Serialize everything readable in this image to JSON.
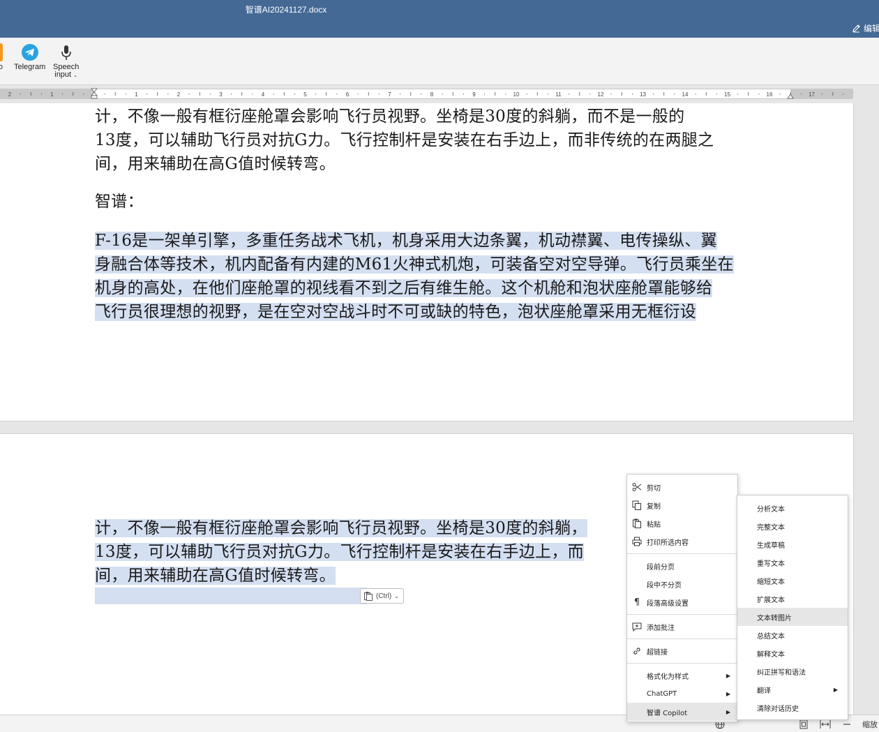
{
  "window": {
    "title": "智谱AI20241127.docx",
    "edit_label": "编辑"
  },
  "ribbon": {
    "items": [
      {
        "label": "io"
      },
      {
        "label": "Telegram"
      },
      {
        "label": "Speech",
        "label2": "input"
      }
    ]
  },
  "ruler": {
    "numbers": [
      "2",
      "1",
      "1",
      "2",
      "3",
      "4",
      "5",
      "6",
      "7",
      "8",
      "9",
      "10",
      "11",
      "12",
      "13",
      "14",
      "15",
      "16",
      "17"
    ]
  },
  "page1": {
    "para1": [
      "计，不像一般有框衍座舱罩会影响飞行员视野。坐椅是30度的斜躺，而不是一般的",
      "13度，可以辅助飞行员对抗G力。飞行控制杆是安装在右手边上，而非传统的在两腿之",
      "间，用来辅助在高G值时候转弯。"
    ],
    "heading": "智谱：",
    "para2": [
      "F-16是一架单引擎，多重任务战术飞机，机身采用大边条翼，机动襟翼、电传操纵、翼",
      "身融合体等技术，机内配备有内建的M61火神式机炮，可装备空对空导弹。飞行员乘坐在",
      "机身的高处，在他们座舱罩的视线看不到之后有维生舱。这个机舱和泡状座舱罩能够给",
      "飞行员很理想的视野，是在空对空战斗时不可或缺的特色，泡状座舱罩采用无框衍设"
    ]
  },
  "page2": {
    "para": [
      "计，不像一般有框衍座舱罩会影响飞行员视野。坐椅是30度的斜躺，",
      "13度，可以辅助飞行员对抗G力。飞行控制杆是安装在右手边上，而",
      "间，用来辅助在高G值时候转弯。"
    ]
  },
  "paste_chip": {
    "label": "(Ctrl)"
  },
  "context_menu": {
    "items": [
      {
        "label": "剪切",
        "icon": "scissors-icon"
      },
      {
        "label": "复制",
        "icon": "copy-icon"
      },
      {
        "label": "粘贴",
        "icon": "paste-icon"
      },
      {
        "label": "打印所选内容",
        "icon": "printer-icon"
      },
      {
        "label": "段前分页",
        "icon": ""
      },
      {
        "label": "段中不分页",
        "icon": ""
      },
      {
        "label": "段落高级设置",
        "icon": "pilcrow-icon"
      },
      {
        "label": "添加批注",
        "icon": "comment-icon"
      },
      {
        "label": "超链接",
        "icon": "link-icon"
      },
      {
        "label": "格式化为样式",
        "icon": "",
        "submenu": true
      },
      {
        "label": "ChatGPT",
        "icon": "",
        "submenu": true
      },
      {
        "label": "智谱 Copilot",
        "icon": "",
        "submenu": true
      }
    ]
  },
  "copilot_submenu": {
    "items": [
      {
        "label": "分析文本"
      },
      {
        "label": "完整文本"
      },
      {
        "label": "生成草稿"
      },
      {
        "label": "重写文本"
      },
      {
        "label": "缩短文本"
      },
      {
        "label": "扩展文本"
      },
      {
        "label": "文本转图片"
      },
      {
        "label": "总结文本"
      },
      {
        "label": "解释文本"
      },
      {
        "label": "纠正拼写和语法"
      },
      {
        "label": "翻译",
        "submenu": true
      },
      {
        "label": "清除对话历史"
      }
    ]
  },
  "statusbar": {
    "zoom_label": "缩放"
  }
}
